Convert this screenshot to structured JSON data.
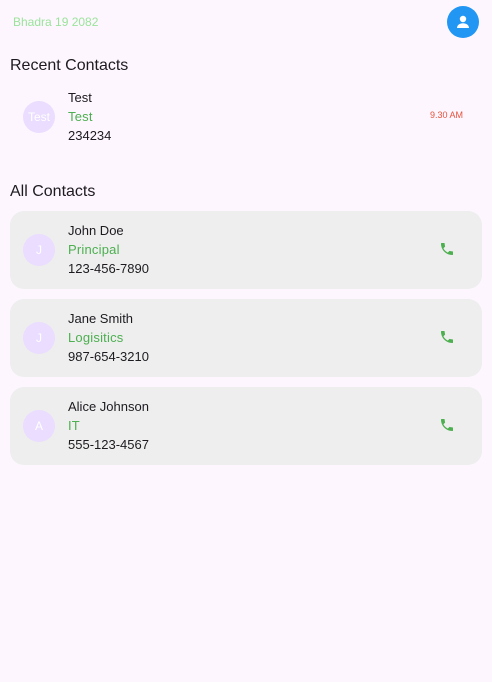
{
  "header": {
    "date": "Bhadra 19 2082"
  },
  "recent": {
    "title": "Recent Contacts",
    "items": [
      {
        "avatar_text": "Test",
        "name": "Test",
        "role": "Test",
        "phone": "234234",
        "time": "9.30 AM"
      }
    ]
  },
  "all": {
    "title": "All Contacts",
    "items": [
      {
        "avatar_text": "J",
        "name": "John Doe",
        "role": "Principal",
        "phone": "123-456-7890"
      },
      {
        "avatar_text": "J",
        "name": "Jane Smith",
        "role": "Logisitics",
        "phone": "987-654-3210"
      },
      {
        "avatar_text": "A",
        "name": "Alice Johnson",
        "role": "IT",
        "phone": "555-123-4567"
      }
    ]
  },
  "colors": {
    "accent": "#2196f3",
    "role": "#4caf50",
    "time": "#e5533d",
    "avatar_bg": "#eaddff",
    "card_bg": "#eeeeee"
  },
  "icons": {
    "profile": "person-icon",
    "call": "phone-icon"
  }
}
